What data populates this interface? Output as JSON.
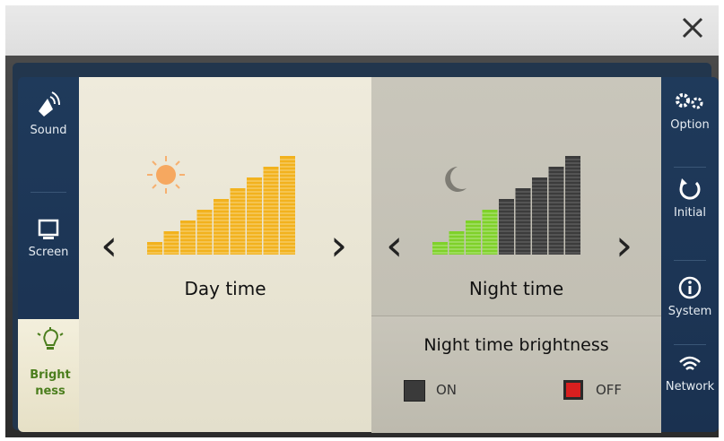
{
  "dialog": {
    "close_label": "✕"
  },
  "left_nav": [
    {
      "id": "sound",
      "label": "Sound",
      "icon": "speaker-icon"
    },
    {
      "id": "screen",
      "label": "Screen",
      "icon": "monitor-icon"
    },
    {
      "id": "brightness",
      "label_line1": "Bright",
      "label_line2": "ness",
      "icon": "lightbulb-icon",
      "active": true
    }
  ],
  "right_nav": [
    {
      "id": "option",
      "label": "Option",
      "icon": "gears-icon"
    },
    {
      "id": "initial",
      "label": "Initial",
      "icon": "reset-icon"
    },
    {
      "id": "system",
      "label": "System",
      "icon": "info-icon"
    },
    {
      "id": "network",
      "label": "Network",
      "icon": "wifi-icon"
    }
  ],
  "day": {
    "title": "Day time",
    "level": 9,
    "max": 9,
    "color": "#f2b21e"
  },
  "night": {
    "title": "Night time",
    "level": 4,
    "max": 9,
    "color": "#7fd12a"
  },
  "night_brightness": {
    "title": "Night time brightness",
    "on_label": "ON",
    "off_label": "OFF",
    "selected": "OFF"
  },
  "colors": {
    "accent_green": "#4b7e1d",
    "off_red": "#d81f1f",
    "nav_bg": "#1f3a5b"
  }
}
